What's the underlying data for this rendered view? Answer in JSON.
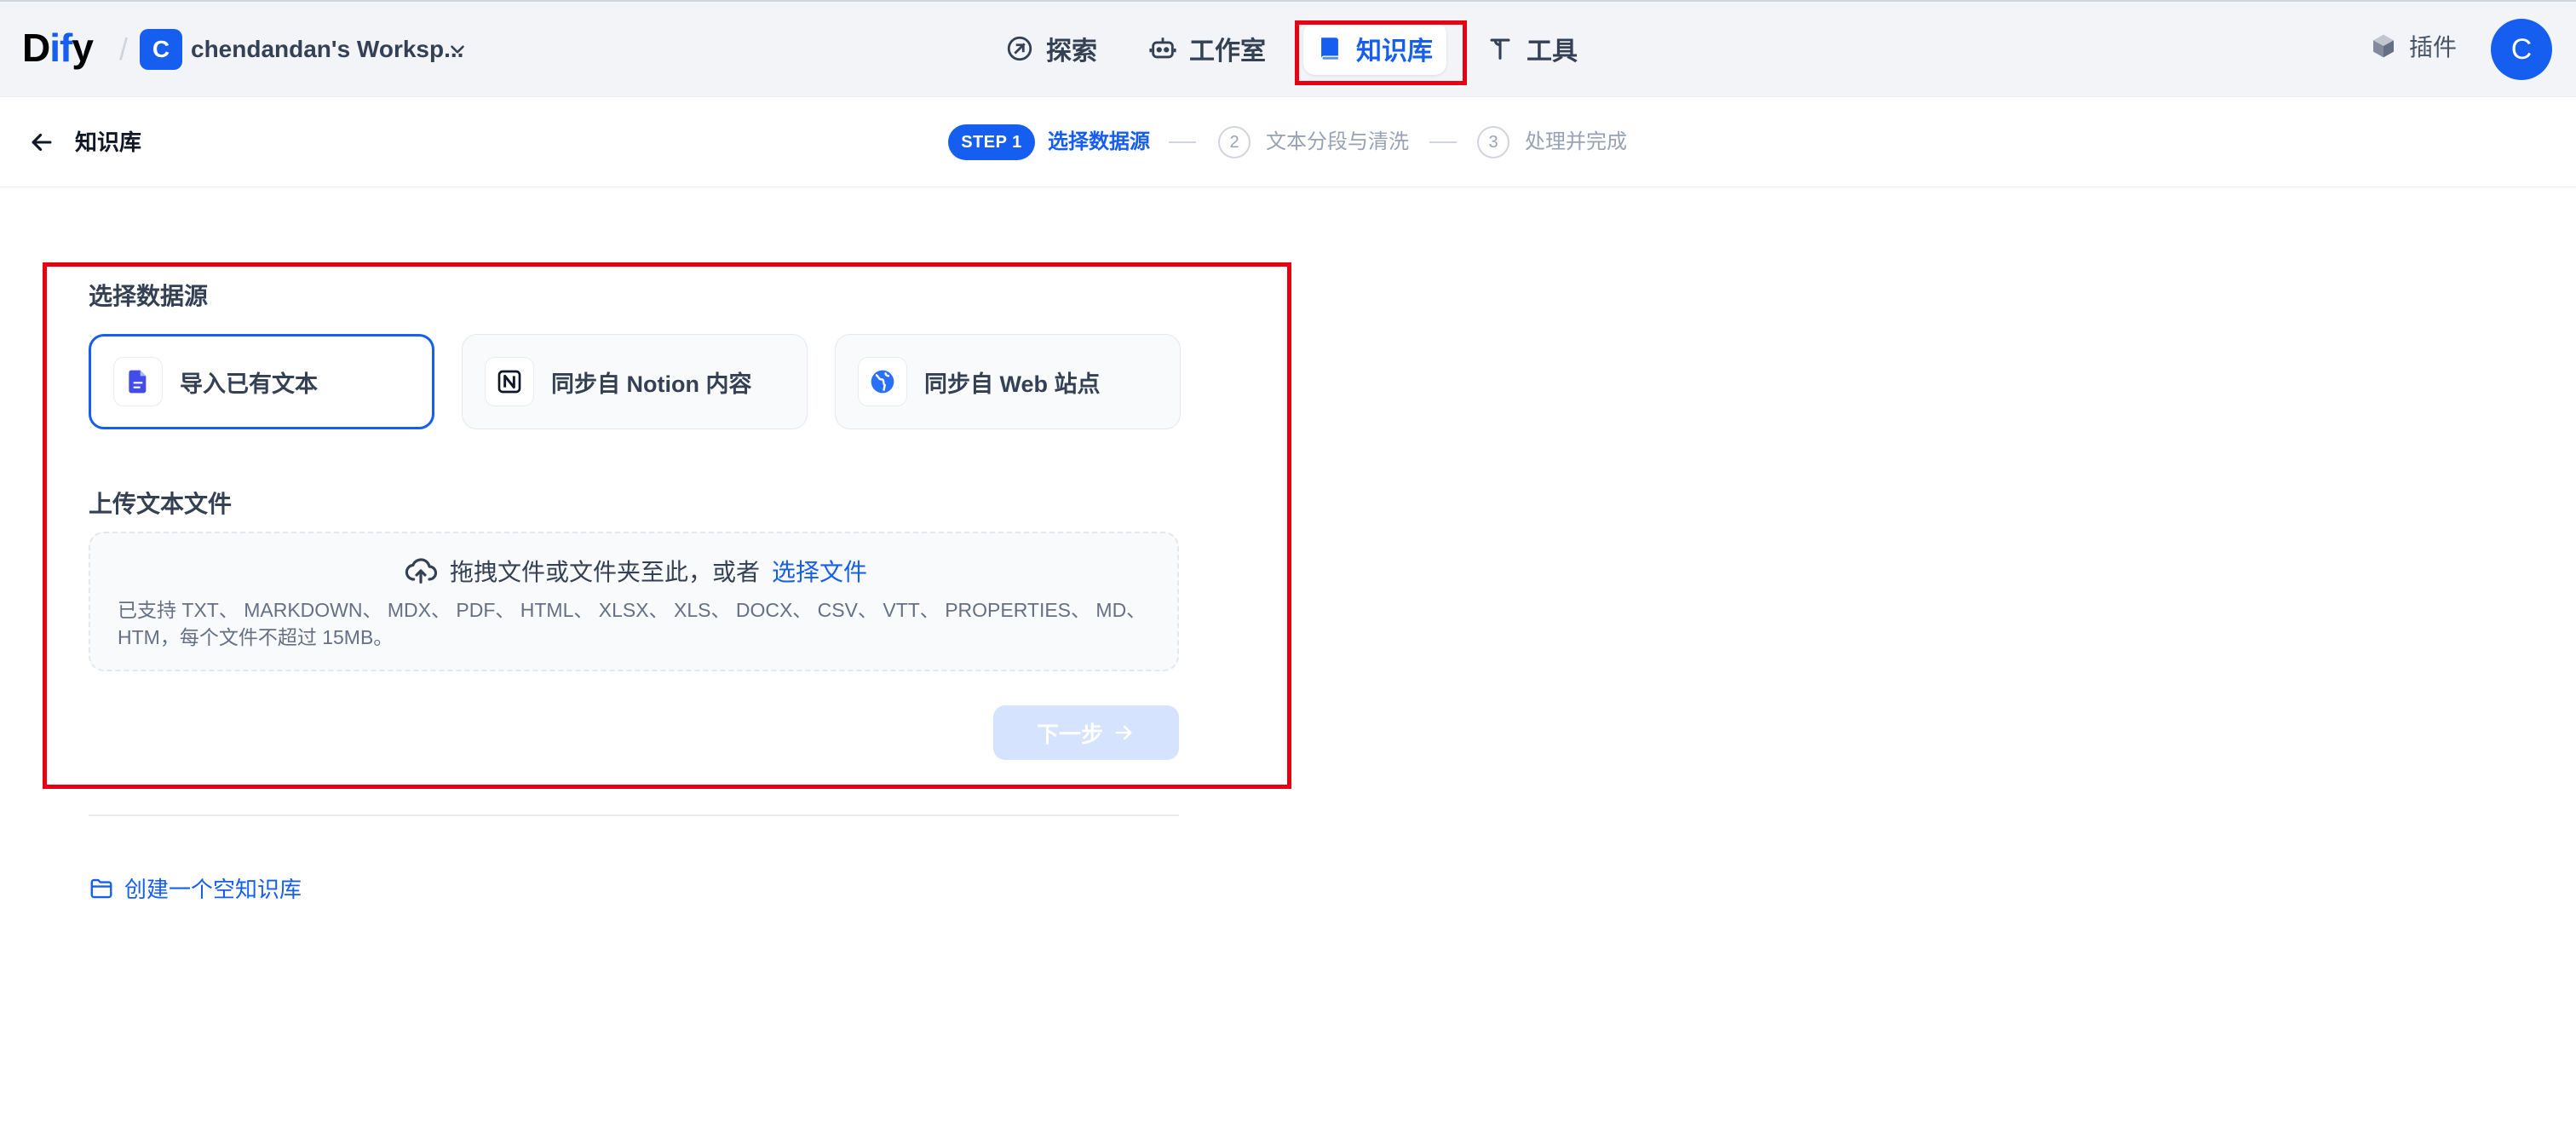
{
  "header": {
    "logo_prefix": "D",
    "logo_highlight": "if",
    "logo_suffix": "y",
    "separator": "/",
    "workspace_initial": "C",
    "workspace_name": "chendandan's Worksp...",
    "nav": [
      {
        "label": "探索",
        "icon": "compass-icon"
      },
      {
        "label": "工作室",
        "icon": "robot-icon"
      },
      {
        "label": "知识库",
        "icon": "book-icon",
        "active": true
      },
      {
        "label": "工具",
        "icon": "tool-icon"
      }
    ],
    "plugin_label": "插件",
    "user_initial": "C"
  },
  "subheader": {
    "back_label": "知识库",
    "steps": [
      {
        "badge": "STEP 1",
        "label": "选择数据源",
        "active": true
      },
      {
        "number": "2",
        "label": "文本分段与清洗"
      },
      {
        "number": "3",
        "label": "处理并完成"
      }
    ]
  },
  "main": {
    "datasource_title": "选择数据源",
    "datasources": [
      {
        "label": "导入已有文本",
        "icon": "file-icon",
        "selected": true
      },
      {
        "label": "同步自 Notion 内容",
        "icon": "notion-icon"
      },
      {
        "label": "同步自 Web 站点",
        "icon": "globe-icon"
      }
    ],
    "upload_title": "上传文本文件",
    "upload_prompt": "拖拽文件或文件夹至此，或者",
    "upload_link": "选择文件",
    "upload_hint": "已支持 TXT、 MARKDOWN、 MDX、 PDF、 HTML、 XLSX、 XLS、 DOCX、 CSV、 VTT、 PROPERTIES、 MD、 HTM，每个文件不超过 15MB。",
    "next_button": "下一步",
    "create_empty": "创建一个空知识库"
  },
  "colors": {
    "accent": "#155eef",
    "highlight_box": "#e60012"
  }
}
